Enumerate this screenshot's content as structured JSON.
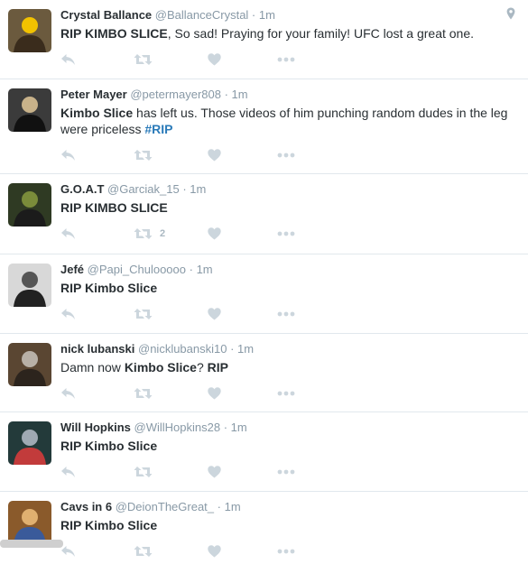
{
  "tweets": [
    {
      "name": "Crystal Ballance",
      "handle": "@BallanceCrystal",
      "time": "1m",
      "parts": [
        {
          "t": "RIP KIMBO SLICE",
          "b": true
        },
        {
          "t": ", So sad! Praying for your family! UFC lost a great one."
        }
      ],
      "retweets": "",
      "has_geo": true
    },
    {
      "name": "Peter Mayer",
      "handle": "@petermayer808",
      "time": "1m",
      "parts": [
        {
          "t": "Kimbo Slice",
          "b": true
        },
        {
          "t": " has left us. Those videos of him punching random dudes in the leg were priceless "
        },
        {
          "t": "#RIP",
          "h": true
        }
      ],
      "retweets": ""
    },
    {
      "name": "G.O.A.T",
      "handle": "@Garciak_15",
      "time": "1m",
      "parts": [
        {
          "t": "RIP KIMBO SLICE",
          "b": true
        }
      ],
      "retweets": "2"
    },
    {
      "name": "Jefé",
      "handle": "@Papi_Chulooooo",
      "time": "1m",
      "parts": [
        {
          "t": "RIP Kimbo Slice",
          "b": true
        }
      ],
      "retweets": ""
    },
    {
      "name": "nick lubanski",
      "handle": "@nicklubanski10",
      "time": "1m",
      "parts": [
        {
          "t": "Damn now "
        },
        {
          "t": "Kimbo Slice",
          "b": true
        },
        {
          "t": "? "
        },
        {
          "t": "RIP",
          "b": true
        }
      ],
      "retweets": ""
    },
    {
      "name": "Will Hopkins",
      "handle": "@WillHopkins28",
      "time": "1m",
      "parts": [
        {
          "t": "RIP Kimbo Slice",
          "b": true
        }
      ],
      "retweets": ""
    },
    {
      "name": "Cavs in 6",
      "handle": "@DeionTheGreat_",
      "time": "1m",
      "parts": [
        {
          "t": "RIP Kimbo Slice",
          "b": true
        }
      ],
      "retweets": ""
    }
  ],
  "colors": {
    "text": "#292f33",
    "muted": "#8899a6",
    "icon": "#ccd6dd",
    "hashtag": "#2b7bb9",
    "divider": "#e1e8ed"
  },
  "icons": {
    "reply": "reply-icon",
    "retweet": "retweet-icon",
    "like": "heart-icon",
    "more": "more-icon",
    "geo": "location-pin-icon"
  }
}
